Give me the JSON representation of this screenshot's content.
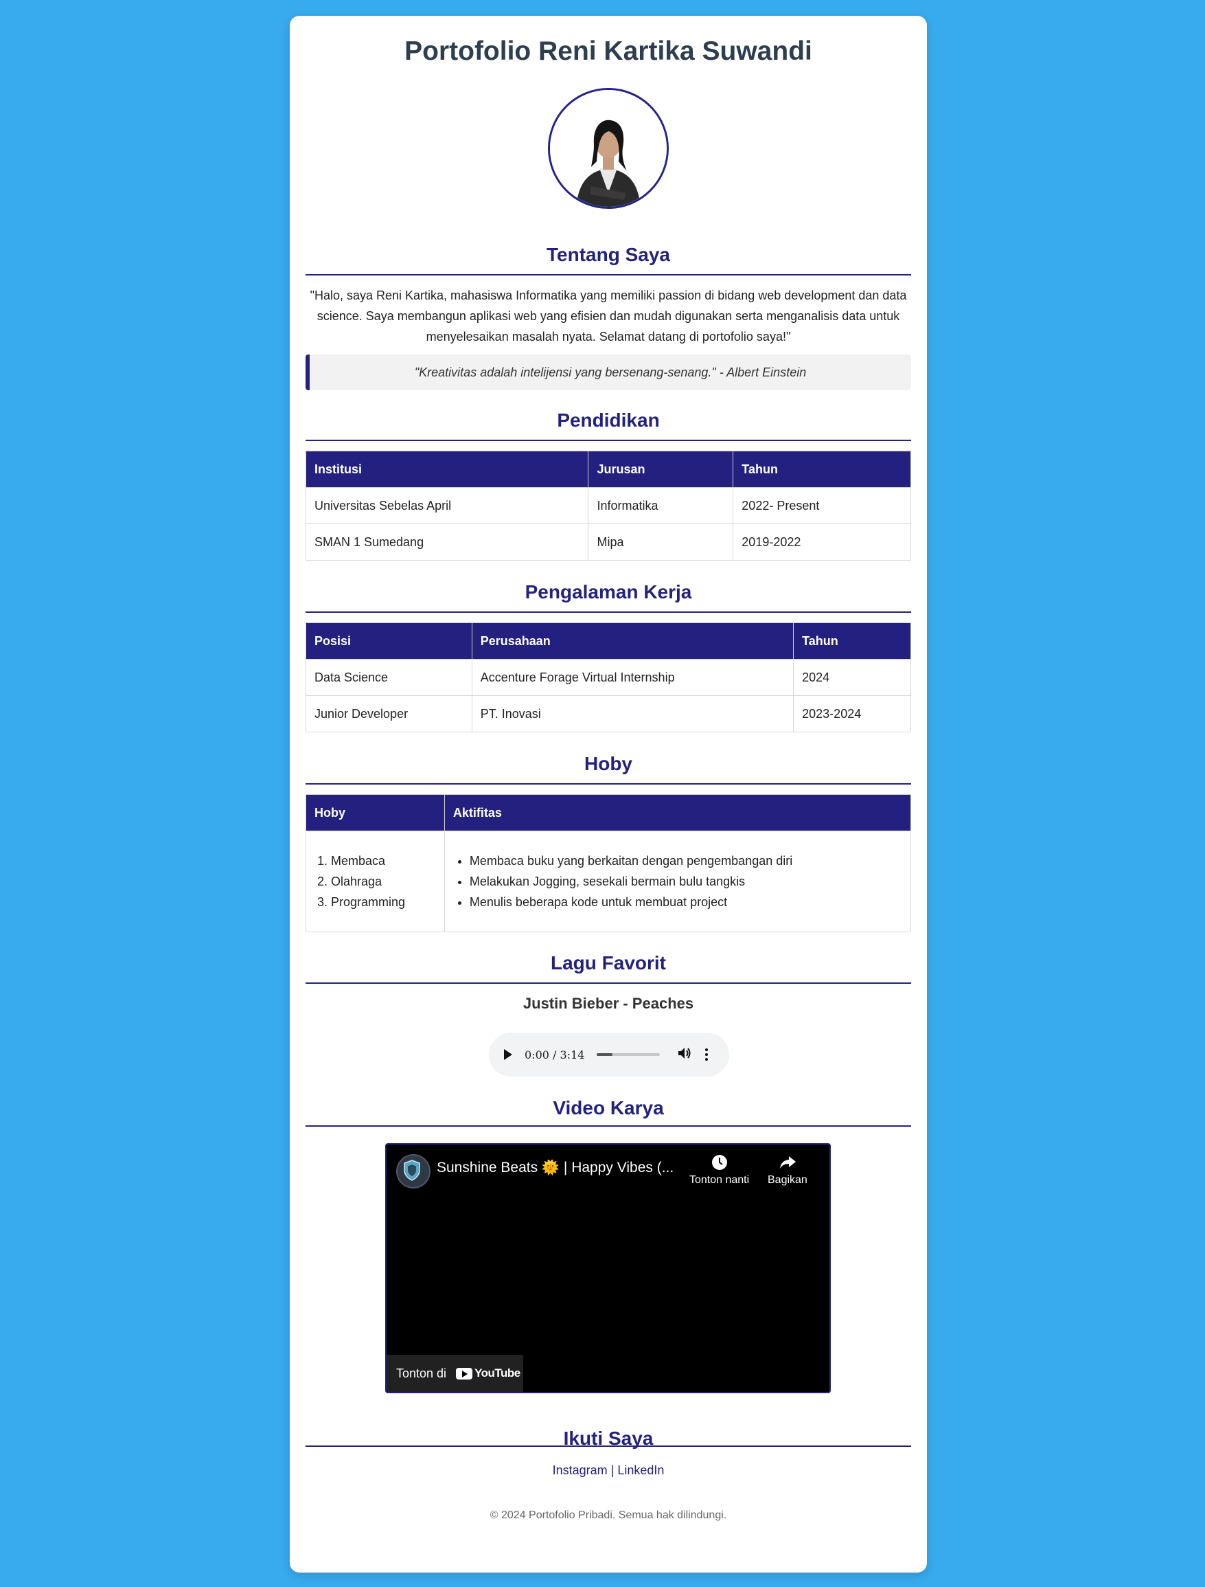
{
  "page_title": "Portofolio Reni Kartika Suwandi",
  "sections": {
    "about": "Tentang Saya",
    "education": "Pendidikan",
    "work": "Pengalaman Kerja",
    "hobby": "Hoby",
    "song": "Lagu Favorit",
    "video": "Video Karya",
    "follow": "Ikuti Saya"
  },
  "about_text": "\"Halo, saya Reni Kartika, mahasiswa Informatika yang memiliki passion di bidang web development dan data science. Saya membangun aplikasi web yang efisien dan mudah digunakan serta menganalisis data untuk menyelesaikan masalah nyata. Selamat datang di portofolio saya!\"",
  "quote": "\"Kreativitas adalah intelijensi yang bersenang-senang.\" - Albert Einstein",
  "education": {
    "headers": [
      "Institusi",
      "Jurusan",
      "Tahun"
    ],
    "rows": [
      [
        "Universitas Sebelas April",
        "Informatika",
        "2022- Present"
      ],
      [
        "SMAN 1 Sumedang",
        "Mipa",
        "2019-2022"
      ]
    ]
  },
  "work": {
    "headers": [
      "Posisi",
      "Perusahaan",
      "Tahun"
    ],
    "rows": [
      [
        "Data Science",
        "Accenture Forage Virtual Internship",
        "2024"
      ],
      [
        "Junior Developer",
        "PT. Inovasi",
        "2023-2024"
      ]
    ]
  },
  "hobby": {
    "headers": [
      "Hoby",
      "Aktifitas"
    ],
    "list": [
      "Membaca",
      "Olahraga",
      "Programming"
    ],
    "activities": [
      "Membaca buku yang berkaitan dengan pengembangan diri",
      "Melakukan Jogging, sesekali bermain bulu tangkis",
      "Menulis beberapa kode untuk membuat project"
    ]
  },
  "song": {
    "title": "Justin Bieber - Peaches",
    "time": "0:00 / 3:14",
    "progress": 0.25
  },
  "video": {
    "title": "Sunshine Beats 🌞 | Happy Vibes (...",
    "watch_later": "Tonton nanti",
    "share": "Bagikan",
    "watch_on": "Tonton di",
    "platform": "YouTube"
  },
  "social": {
    "instagram": "Instagram",
    "separator": "|",
    "linkedin": "LinkedIn"
  },
  "footer": "© 2024 Portofolio Pribadi. Semua hak dilindungi."
}
